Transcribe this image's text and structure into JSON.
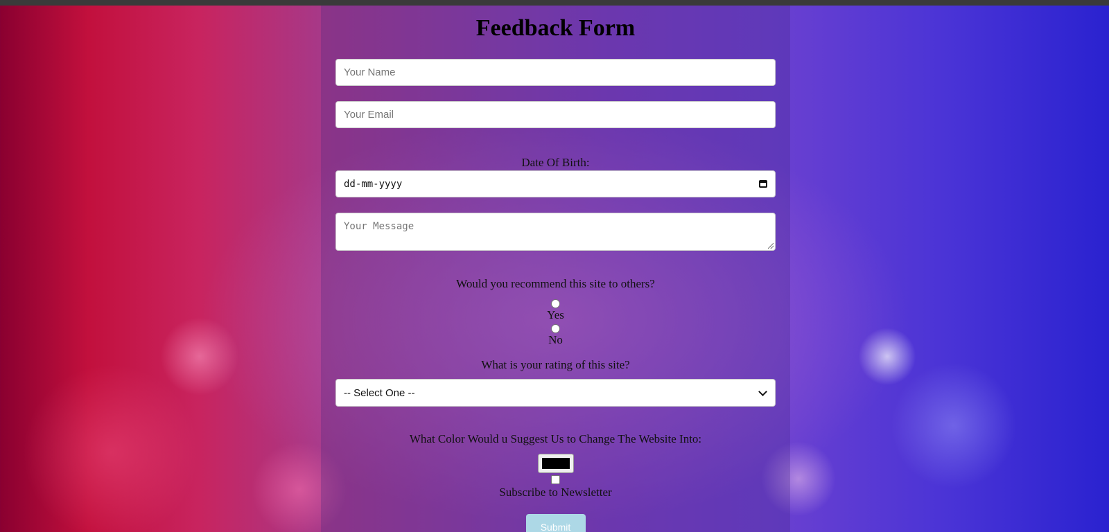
{
  "form": {
    "title": "Feedback Form",
    "name_placeholder": "Your Name",
    "email_placeholder": "Your Email",
    "dob_label": "Date Of Birth:",
    "dob_value": "dd-mm-yyyy",
    "message_placeholder": "Your Message",
    "recommend_question": "Would you recommend this site to others?",
    "recommend_options": [
      "Yes",
      "No"
    ],
    "rating_question": "What is your rating of this site?",
    "rating_selected": "-- Select One --",
    "color_question": "What Color Would u Suggest Us to Change The Website Into:",
    "color_value": "#000000",
    "newsletter_label": "Subscribe to Newsletter",
    "submit_label": "Submit"
  },
  "colors": {
    "submit_background": "#add8e6",
    "panel_tint": "#46288250"
  },
  "icons": {
    "calendar": "calendar-icon",
    "select_chevron": "chevron-down-icon",
    "textarea_resize": "resize-grip-icon"
  }
}
